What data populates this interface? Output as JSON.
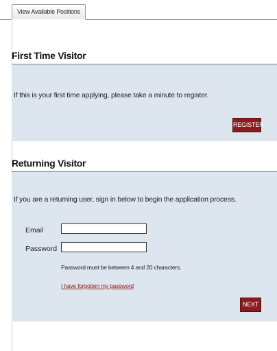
{
  "tabs": {
    "active_label": "View Available Positions"
  },
  "first_time": {
    "title": "First Time Visitor",
    "message": "If this is your first time applying, please take a minute to register.",
    "register_label": "REGISTER"
  },
  "returning": {
    "title": "Returning Visitor",
    "message": "If you are a returning user, sign in below to begin the application process.",
    "email_label": "Email",
    "email_value": "",
    "password_label": "Password",
    "password_value": "",
    "password_hint": "Password must be between 4 and 20 characters.",
    "forgot_link": "I have forgotten my password",
    "next_label": "NEXT"
  },
  "colors": {
    "panel_bg": "#dde5ee",
    "button_bg": "#8b1b1f",
    "link": "#8b1b1f"
  }
}
